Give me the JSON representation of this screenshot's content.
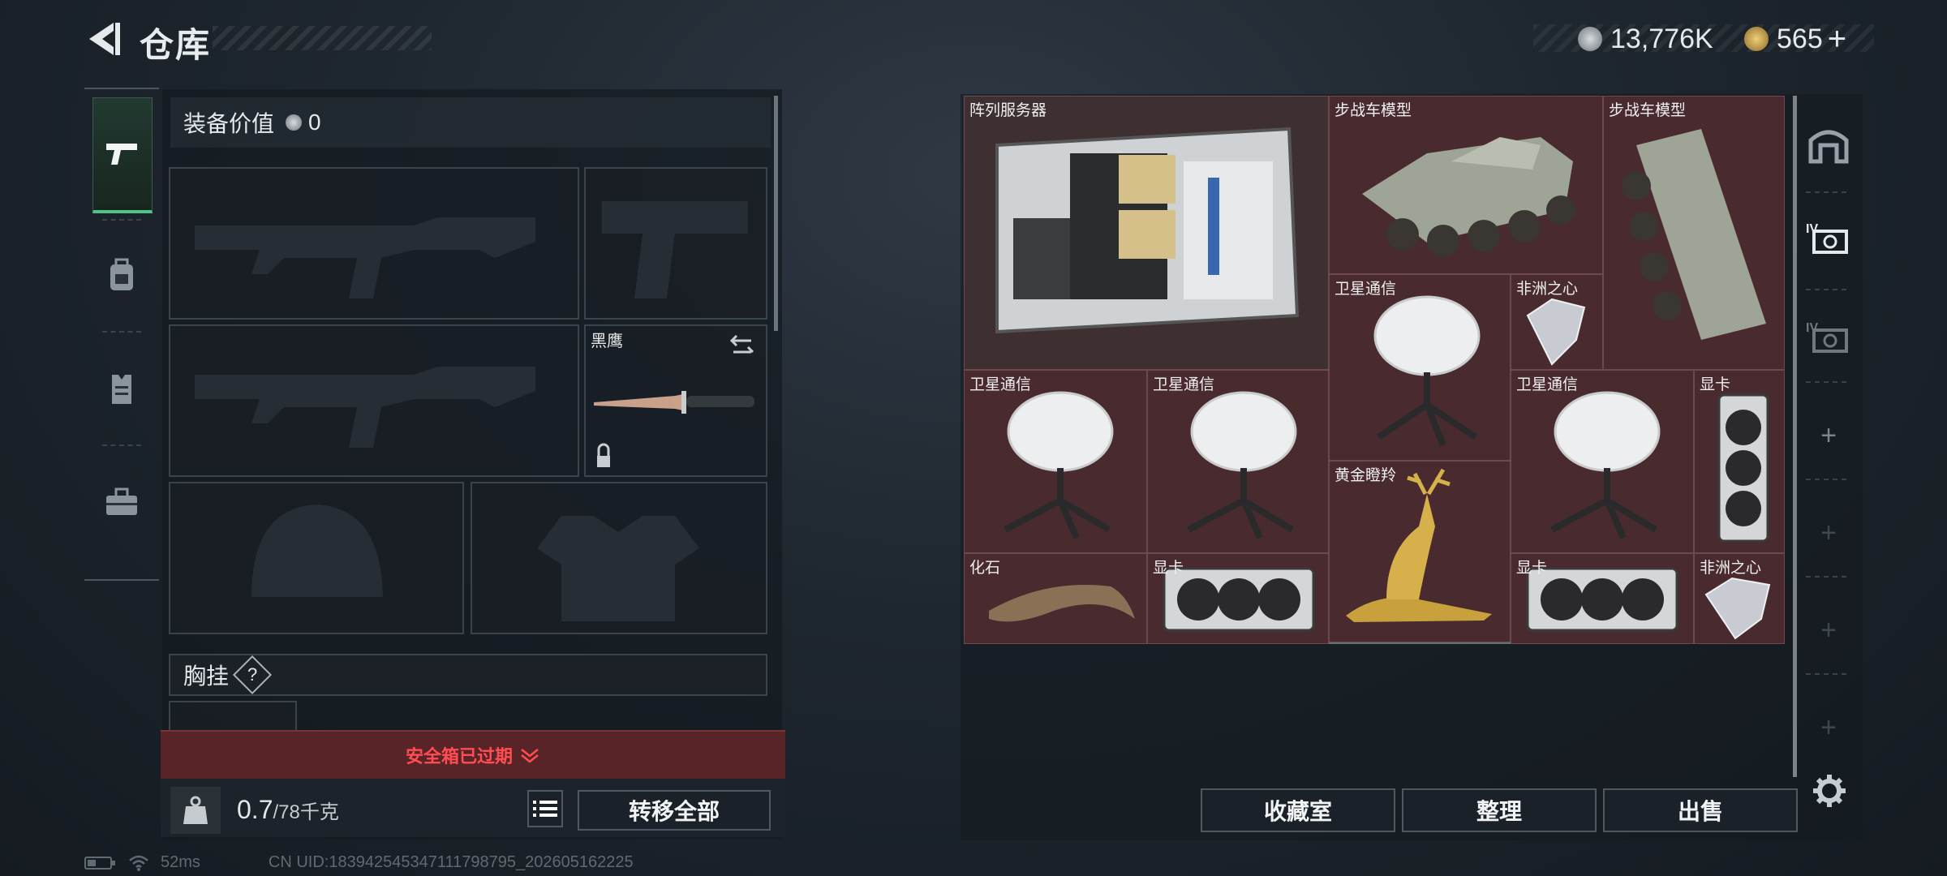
{
  "header": {
    "title": "仓库"
  },
  "currency": {
    "coins": "13,776K",
    "premium": "565"
  },
  "loadout": {
    "equipment_value_label": "装备价值",
    "equipment_value": "0",
    "melee_label": "黑鹰",
    "chest_rig_label": "胸挂",
    "chest_rig_help": "?",
    "safe_box_status": "安全箱已过期",
    "weight_current": "0.7",
    "weight_max": "/78千克",
    "transfer_all": "转移全部"
  },
  "storage": {
    "items": [
      {
        "label": "阵列服务器",
        "icon": "server-icon"
      },
      {
        "label": "步战车模型",
        "icon": "ifv-model-icon"
      },
      {
        "label": "步战车模型",
        "icon": "ifv-model-icon"
      },
      {
        "label": "卫星通信",
        "icon": "satellite-dish-icon"
      },
      {
        "label": "非洲之心",
        "icon": "diamond-icon"
      },
      {
        "label": "卫星通信",
        "icon": "satellite-dish-icon"
      },
      {
        "label": "卫星通信",
        "icon": "satellite-dish-icon"
      },
      {
        "label": "卫星通信",
        "icon": "satellite-dish-icon"
      },
      {
        "label": "显卡",
        "icon": "gpu-icon"
      },
      {
        "label": "黄金瞪羚",
        "icon": "golden-gazelle-icon"
      },
      {
        "label": "化石",
        "icon": "fossil-claw-icon"
      },
      {
        "label": "显卡",
        "icon": "gpu-icon"
      },
      {
        "label": "显卡",
        "icon": "gpu-icon"
      },
      {
        "label": "非洲之心",
        "icon": "diamond-icon"
      }
    ],
    "buttons": {
      "collection": "收藏室",
      "organize": "整理",
      "sell": "出售"
    }
  },
  "status_bar": {
    "ping": "52ms",
    "uid": "CN UID:1839425453471117987​95_202605162225"
  },
  "colors": {
    "accent_green": "#4fc389",
    "alert_red": "#ff4d52",
    "item_bg": "#482a2f"
  }
}
